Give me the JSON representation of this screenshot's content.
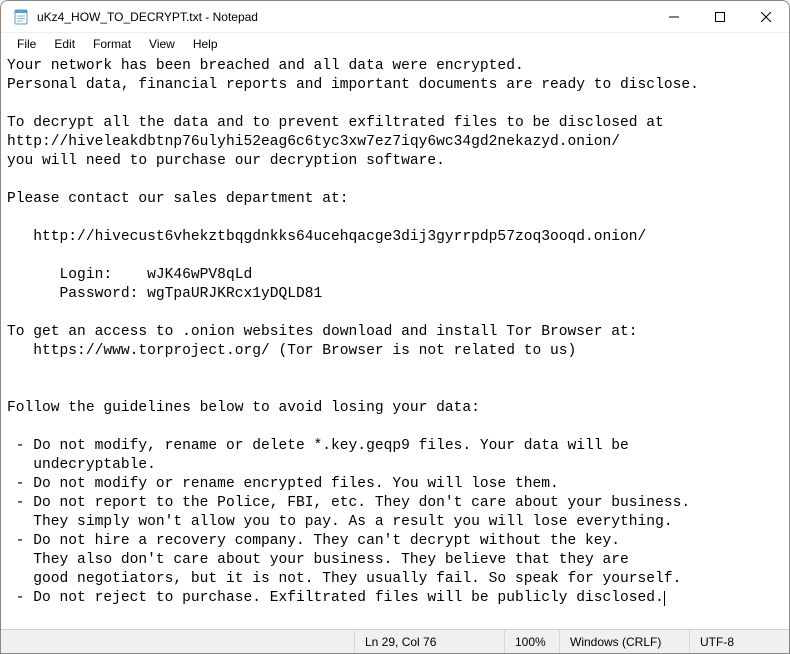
{
  "titlebar": {
    "title": "uKz4_HOW_TO_DECRYPT.txt - Notepad"
  },
  "menu": {
    "file": "File",
    "edit": "Edit",
    "format": "Format",
    "view": "View",
    "help": "Help"
  },
  "content": {
    "line1": "Your network has been breached and all data were encrypted.",
    "line2": "Personal data, financial reports and important documents are ready to disclose.",
    "line3": "",
    "line4": "To decrypt all the data and to prevent exfiltrated files to be disclosed at",
    "line5": "http://hiveleakdbtnp76ulyhi52eag6c6tyc3xw7ez7iqy6wc34gd2nekazyd.onion/",
    "line6": "you will need to purchase our decryption software.",
    "line7": "",
    "line8": "Please contact our sales department at:",
    "line9": "",
    "line10": "   http://hivecust6vhekztbqgdnkks64ucehqacge3dij3gyrrpdp57zoq3ooqd.onion/",
    "line11": "",
    "line12": "      Login:    wJK46wPV8qLd",
    "line13": "      Password: wgTpaURJKRcx1yDQLD81",
    "line14": "",
    "line15": "To get an access to .onion websites download and install Tor Browser at:",
    "line16": "   https://www.torproject.org/ (Tor Browser is not related to us)",
    "line17": "",
    "line18": "",
    "line19": "Follow the guidelines below to avoid losing your data:",
    "line20": "",
    "line21": " - Do not modify, rename or delete *.key.geqp9 files. Your data will be",
    "line22": "   undecryptable.",
    "line23": " - Do not modify or rename encrypted files. You will lose them.",
    "line24": " - Do not report to the Police, FBI, etc. They don't care about your business.",
    "line25": "   They simply won't allow you to pay. As a result you will lose everything.",
    "line26": " - Do not hire a recovery company. They can't decrypt without the key.",
    "line27": "   They also don't care about your business. They believe that they are",
    "line28": "   good negotiators, but it is not. They usually fail. So speak for yourself.",
    "line29": " - Do not reject to purchase. Exfiltrated files will be publicly disclosed."
  },
  "statusbar": {
    "position": "Ln 29, Col 76",
    "zoom": "100%",
    "lineending": "Windows (CRLF)",
    "encoding": "UTF-8"
  }
}
